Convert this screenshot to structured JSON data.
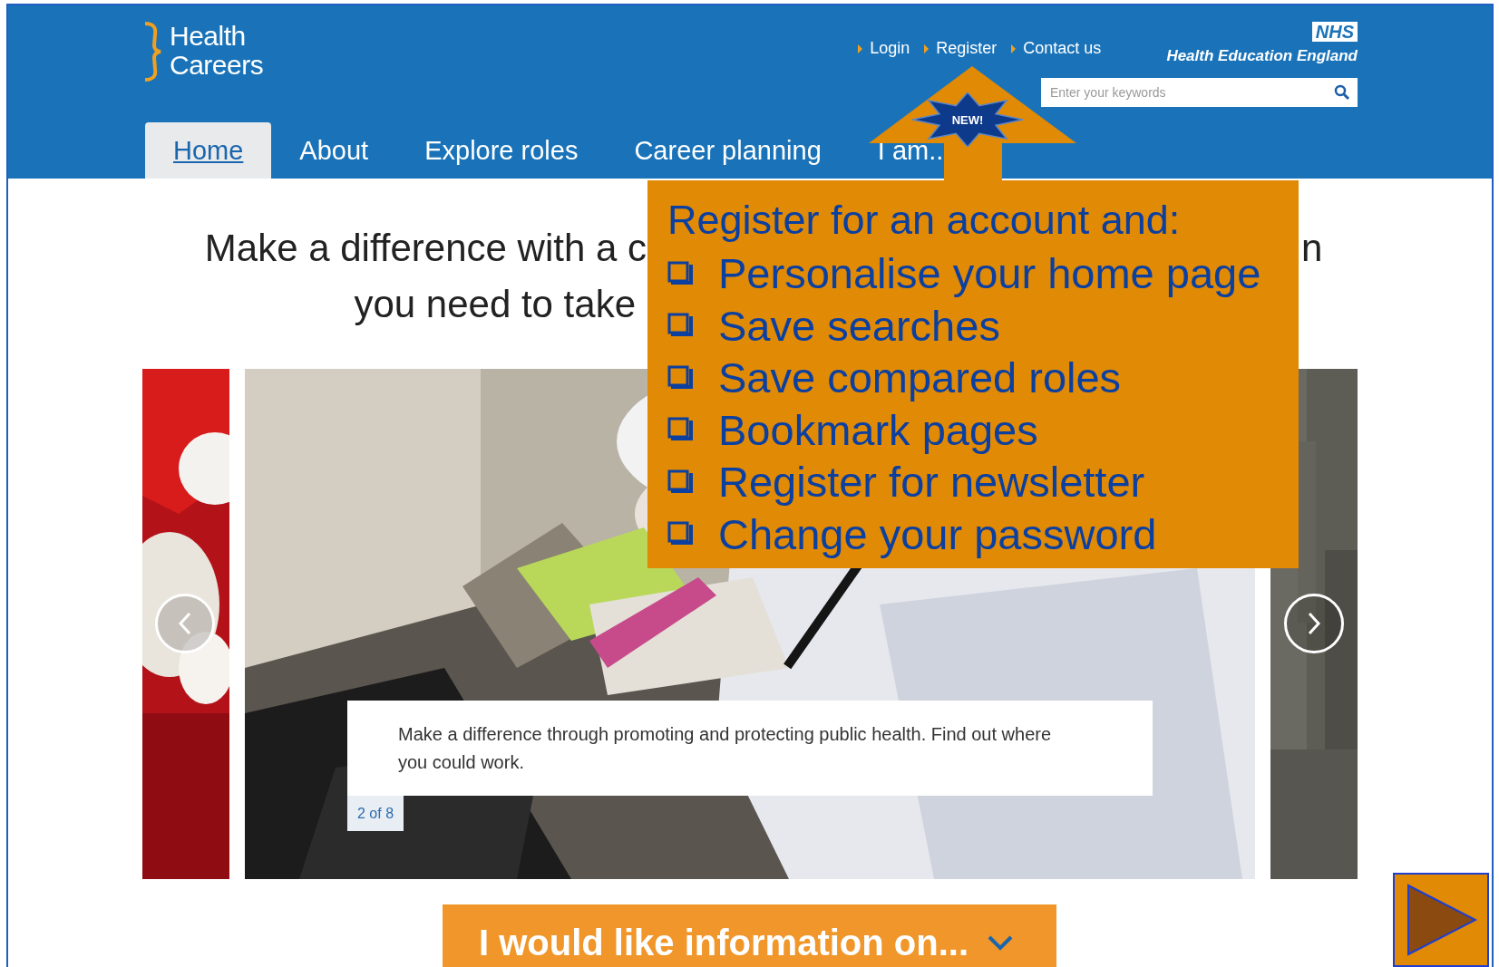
{
  "header": {
    "logo": [
      "Health",
      "Careers"
    ],
    "top_links": [
      "Login",
      "Register",
      "Contact us"
    ],
    "nhs_badge": "NHS",
    "organisation": "Health Education England",
    "search": {
      "placeholder": "Enter your keywords"
    }
  },
  "nav": [
    {
      "label": "Home",
      "selected": true
    },
    {
      "label": "About",
      "selected": false
    },
    {
      "label": "Explore roles",
      "selected": false
    },
    {
      "label": "Career planning",
      "selected": false
    },
    {
      "label": "I am..",
      "selected": false
    }
  ],
  "headline": {
    "line_1_left": "Make a difference with a c",
    "line_1_right": "n",
    "line_2": "you need to take"
  },
  "carousel": {
    "caption": "Make a difference through promoting and protecting public health. Find out where you could work.",
    "counter": "2 of 8"
  },
  "info_button": "I would like information on...",
  "callout": {
    "badge": "NEW!",
    "title": "Register for an account and:",
    "items": [
      "Personalise your home page",
      "Save searches",
      "Save compared roles",
      "Bookmark pages",
      "Register for newsletter",
      "Change your password"
    ]
  }
}
